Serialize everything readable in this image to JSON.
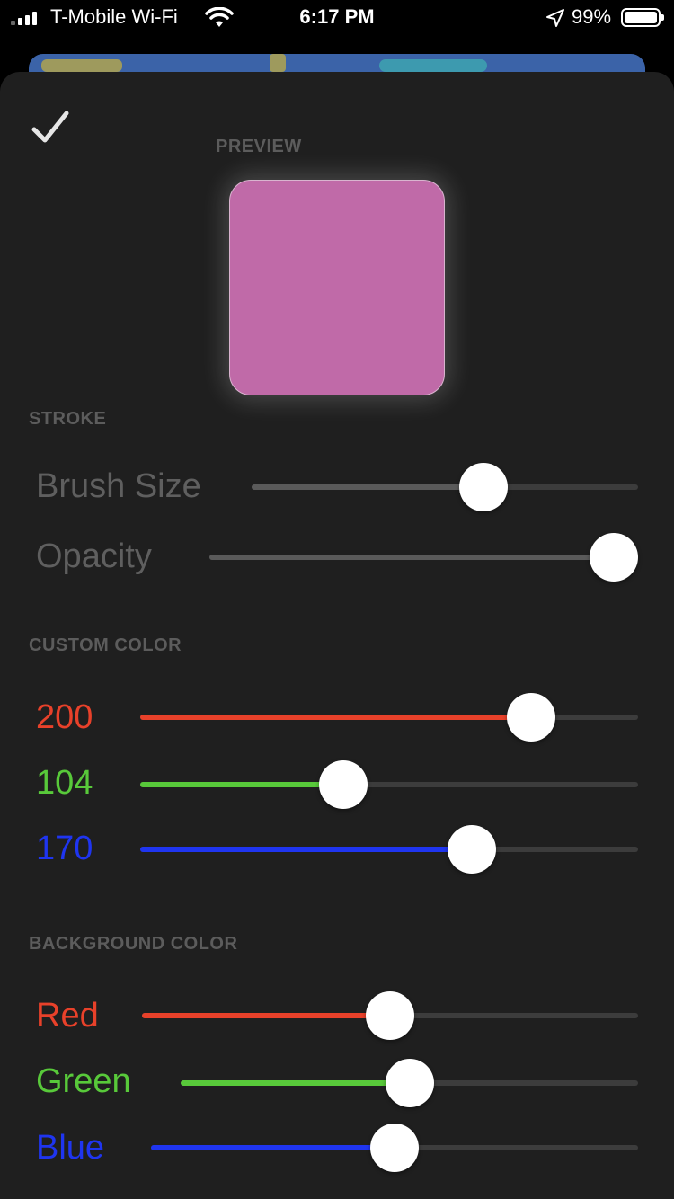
{
  "status": {
    "carrier": "T-Mobile Wi-Fi",
    "time": "6:17 PM",
    "battery": "99%",
    "wifi_icon": "wifi-icon",
    "location_icon": "location-arrow-icon"
  },
  "toolbar": {
    "done_icon": "checkmark-icon"
  },
  "preview": {
    "title": "PREVIEW",
    "swatch_color": "#c06aa8"
  },
  "stroke": {
    "title": "STROKE",
    "brush_size": {
      "label": "Brush Size",
      "value": 0.6
    },
    "opacity": {
      "label": "Opacity",
      "value": 1.0
    }
  },
  "custom_color": {
    "title": "CUSTOM COLOR",
    "red": {
      "label": "200",
      "value": 200,
      "max": 255,
      "color": "#e8412a"
    },
    "green": {
      "label": "104",
      "value": 104,
      "max": 255,
      "color": "#58c93a"
    },
    "blue": {
      "label": "170",
      "value": 170,
      "max": 255,
      "color": "#1f35f0"
    }
  },
  "background_color": {
    "title": "BACKGROUND COLOR",
    "red": {
      "label": "Red",
      "value": 0.5,
      "color": "#e8412a"
    },
    "green": {
      "label": "Green",
      "value": 0.5,
      "color": "#58c93a"
    },
    "blue": {
      "label": "Blue",
      "value": 0.5,
      "color": "#1f35f0"
    }
  }
}
